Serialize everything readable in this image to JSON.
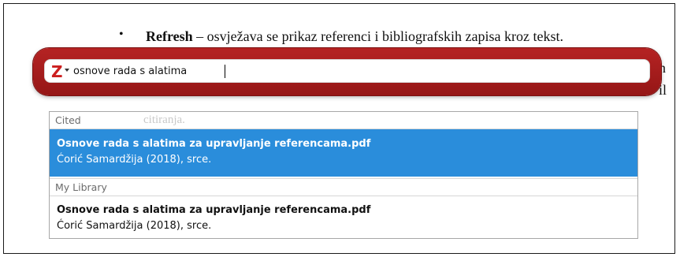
{
  "document": {
    "bullet": "•",
    "refresh_term": "Refresh",
    "refresh_desc": " – osvježava se prikaz referenci i bibliografskih zapisa kroz tekst.",
    "peek_1": "n",
    "peek_2": "il",
    "ghost_text": "citiranja."
  },
  "zotero": {
    "logo": "Z",
    "search_value": "osnove rada s alatima"
  },
  "results": {
    "sections": [
      {
        "label": "Cited",
        "items": [
          {
            "title": "Osnove rada s alatima za upravljanje referencama.pdf",
            "meta": "Ćorić Samardžija (2018), srce.",
            "selected": true
          }
        ]
      },
      {
        "label": "My Library",
        "items": [
          {
            "title": "Osnove rada s alatima za upravljanje referencama.pdf",
            "meta": "Ćorić Samardžija (2018), srce.",
            "selected": false
          }
        ]
      }
    ]
  },
  "colors": {
    "bar_red": "#a51c1c",
    "selection_blue": "#2a8ddb"
  }
}
